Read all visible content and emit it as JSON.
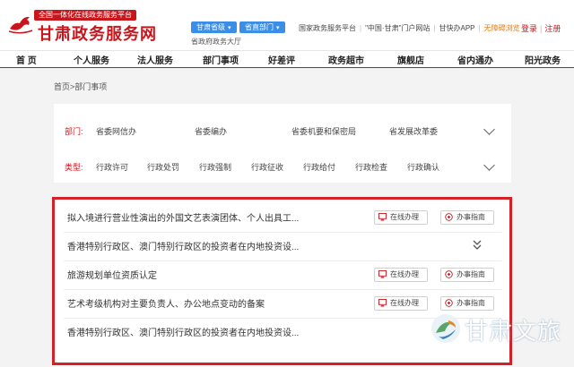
{
  "header": {
    "slogan": "全国一体化在线政务服务平台",
    "site_title": "甘肃政务服务网",
    "province_select": "甘肃省级",
    "dept_select": "省直部门",
    "hall_label": "省政府政务大厅",
    "links": [
      "国家政务服务平台",
      "\"中国·甘肃\"门户网站",
      "甘快办APP",
      "无障碍浏览"
    ],
    "login": "登录",
    "register": "注册"
  },
  "nav": {
    "items": [
      "首 页",
      "个人服务",
      "法人服务",
      "部门事项",
      "好差评",
      "政务超市",
      "旗舰店",
      "省内通办",
      "阳光政务"
    ]
  },
  "breadcrumb": "首页>部门事项",
  "filters": {
    "dept_label": "部门:",
    "dept_options": [
      "省委网信办",
      "省委编办",
      "省委机要和保密局",
      "省发展改革委"
    ],
    "type_label": "类型:",
    "type_options": [
      "行政许可",
      "行政处罚",
      "行政强制",
      "行政征收",
      "行政给付",
      "行政检查",
      "行政确认"
    ]
  },
  "items": [
    {
      "title": "拟入境进行营业性演出的外国文艺表演团体、个人出具工...",
      "online": "在线办理",
      "guide": "办事指南"
    },
    {
      "title": "香港特别行政区、澳门特别行政区的投资者在内地投资设...",
      "online": "",
      "guide": ""
    },
    {
      "title": "旅游规划单位资质认定",
      "online": "在线办理",
      "guide": "办事指南"
    },
    {
      "title": "艺术考级机构对主要负责人、办公地点变动的备案",
      "online": "在线办理",
      "guide": "办事指南"
    },
    {
      "title": "香港特别行政区、澳门特别行政区的投资者在内地投资设...",
      "online": "",
      "guide": ""
    }
  ],
  "watermark": "甘肃文旅",
  "colors": {
    "brand_red": "#c8161d",
    "select_blue": "#3a8ee6",
    "highlight_border": "#d42027"
  }
}
